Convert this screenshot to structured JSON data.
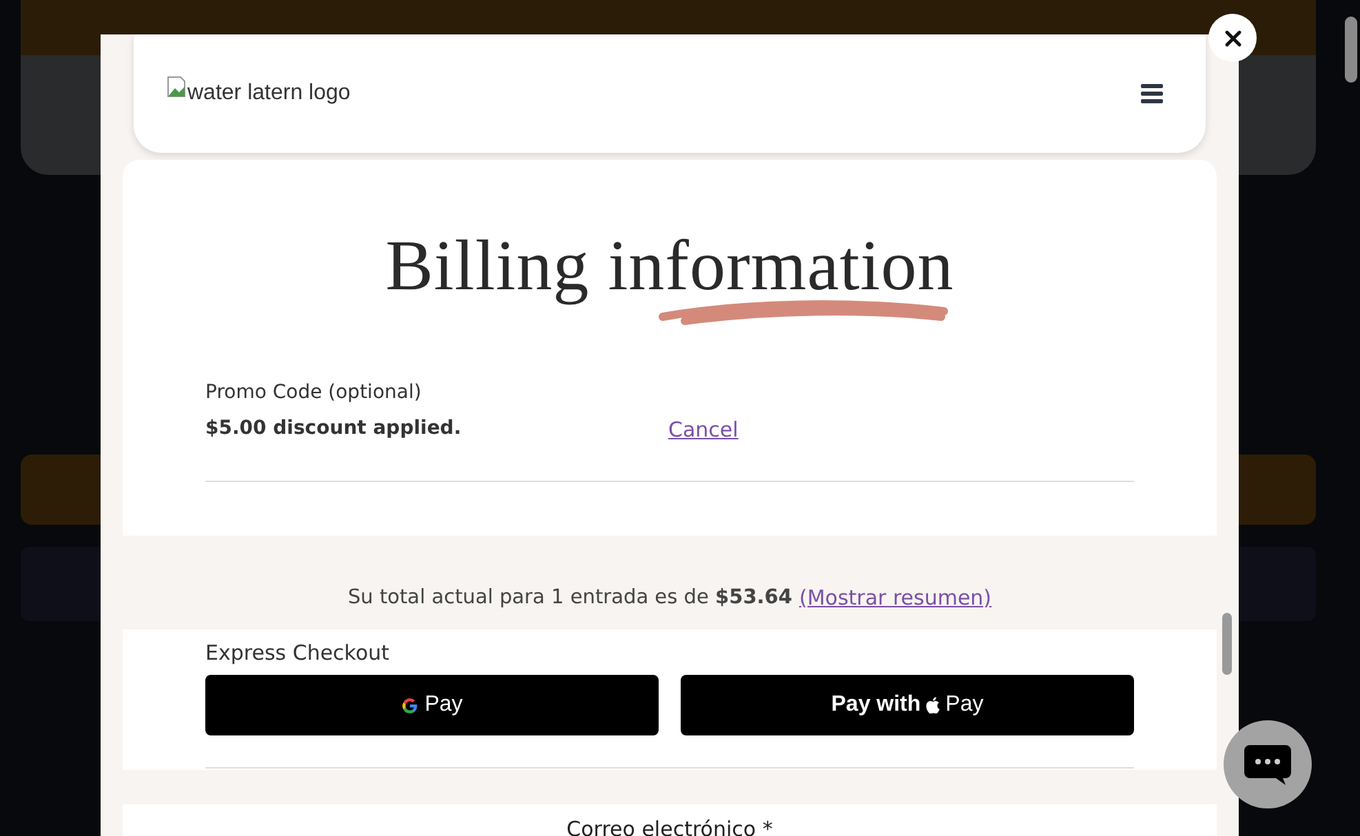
{
  "header": {
    "logo_alt": "water latern logo"
  },
  "billing": {
    "title": "Billing information",
    "promo_label": "Promo Code (optional)",
    "promo_status": "$5.00 discount applied.",
    "cancel_link": "Cancel"
  },
  "total": {
    "text": "Su total actual para 1 entrada es de **$53.64**",
    "summary_link": "(Mostrar resumen)"
  },
  "express": {
    "label": "Express Checkout",
    "buttons": [
      {
        "kind": "google_pay",
        "label": "Pay"
      },
      {
        "kind": "apple_pay",
        "prefix": "Pay with",
        "label": "Pay"
      }
    ]
  },
  "email": {
    "label": "Correo electrónico *"
  }
}
